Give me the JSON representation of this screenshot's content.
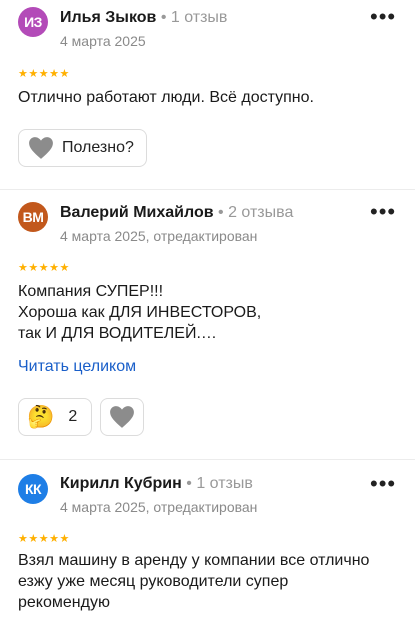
{
  "colors": {
    "accent": "#1a5fc9",
    "star": "#ffb000",
    "avatar1": "#b34bb8",
    "avatar2": "#c2581c",
    "avatar3": "#1e7ee6"
  },
  "reviews": [
    {
      "initials": "ИЗ",
      "name": "Илья Зыков",
      "count": "1 отзыв",
      "date": "4 марта 2025",
      "stars": "★★★★★",
      "text": "Отлично работают люди. Всё доступно.",
      "helpful_label": "Полезно?"
    },
    {
      "initials": "ВМ",
      "name": "Валерий Михайлов",
      "count": "2 отзыва",
      "date": "4 марта 2025, отредактирован",
      "stars": "★★★★★",
      "text_lines": [
        "Компания СУПЕР!!!",
        "Хороша как ДЛЯ ИНВЕСТОРОВ,",
        "так И ДЛЯ ВОДИТЕЛЕЙ.…"
      ],
      "read_more": "Читать целиком",
      "reaction_emoji": "🤔",
      "reaction_count": "2"
    },
    {
      "initials": "КК",
      "name": "Кирилл Кубрин",
      "count": "1 отзыв",
      "date": "4 марта 2025, отредактирован",
      "stars": "★★★★★",
      "text_lines": [
        "Взял машину в аренду у компании все отлично",
        "езжу уже месяц руководители супер",
        "рекомендую"
      ]
    }
  ],
  "icons": {
    "more": "more-dots-icon",
    "heart": "heart-icon",
    "thinking": "thinking-face-icon"
  }
}
